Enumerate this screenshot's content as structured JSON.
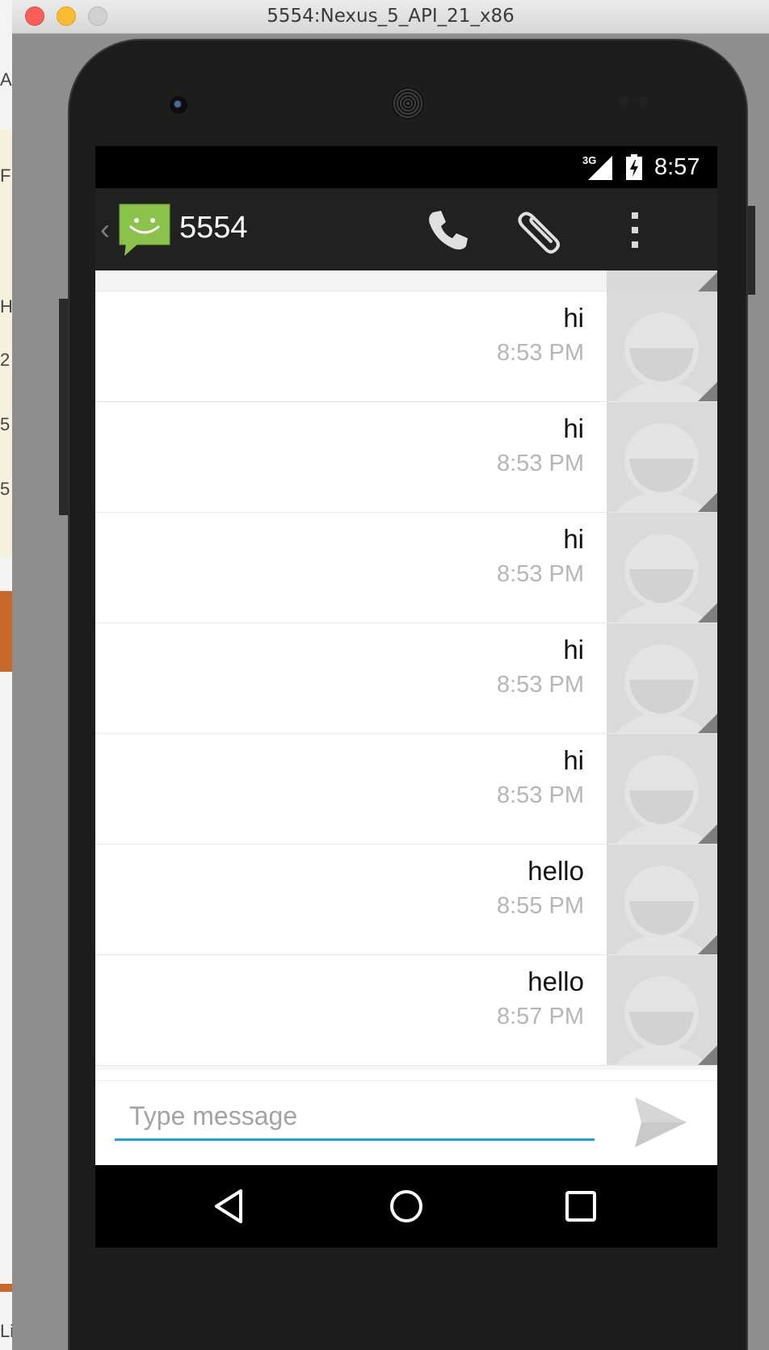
{
  "window": {
    "title": "5554:Nexus_5_API_21_x86"
  },
  "background_app": {
    "fragments": [
      "Ar",
      "F",
      "H",
      "2",
      "5",
      "5",
      "Li"
    ]
  },
  "statusbar": {
    "network": "3G",
    "time": "8:57"
  },
  "actionbar": {
    "title": "5554"
  },
  "messages": [
    {
      "text": "hi",
      "time": "8:53 PM"
    },
    {
      "text": "hi",
      "time": "8:53 PM"
    },
    {
      "text": "hi",
      "time": "8:53 PM"
    },
    {
      "text": "hi",
      "time": "8:53 PM"
    },
    {
      "text": "hi",
      "time": "8:53 PM"
    },
    {
      "text": "hello",
      "time": "8:55 PM"
    },
    {
      "text": "hello",
      "time": "8:57 PM"
    }
  ],
  "compose": {
    "placeholder": "Type message",
    "value": ""
  },
  "colors": {
    "app_green": "#8bc34a",
    "accent_blue": "#1ba0d9",
    "actionbar": "#212121"
  },
  "icons": [
    "back-chevron",
    "messaging-app",
    "phone",
    "paperclip",
    "overflow-menu",
    "send",
    "nav-back",
    "nav-home",
    "nav-recents"
  ]
}
